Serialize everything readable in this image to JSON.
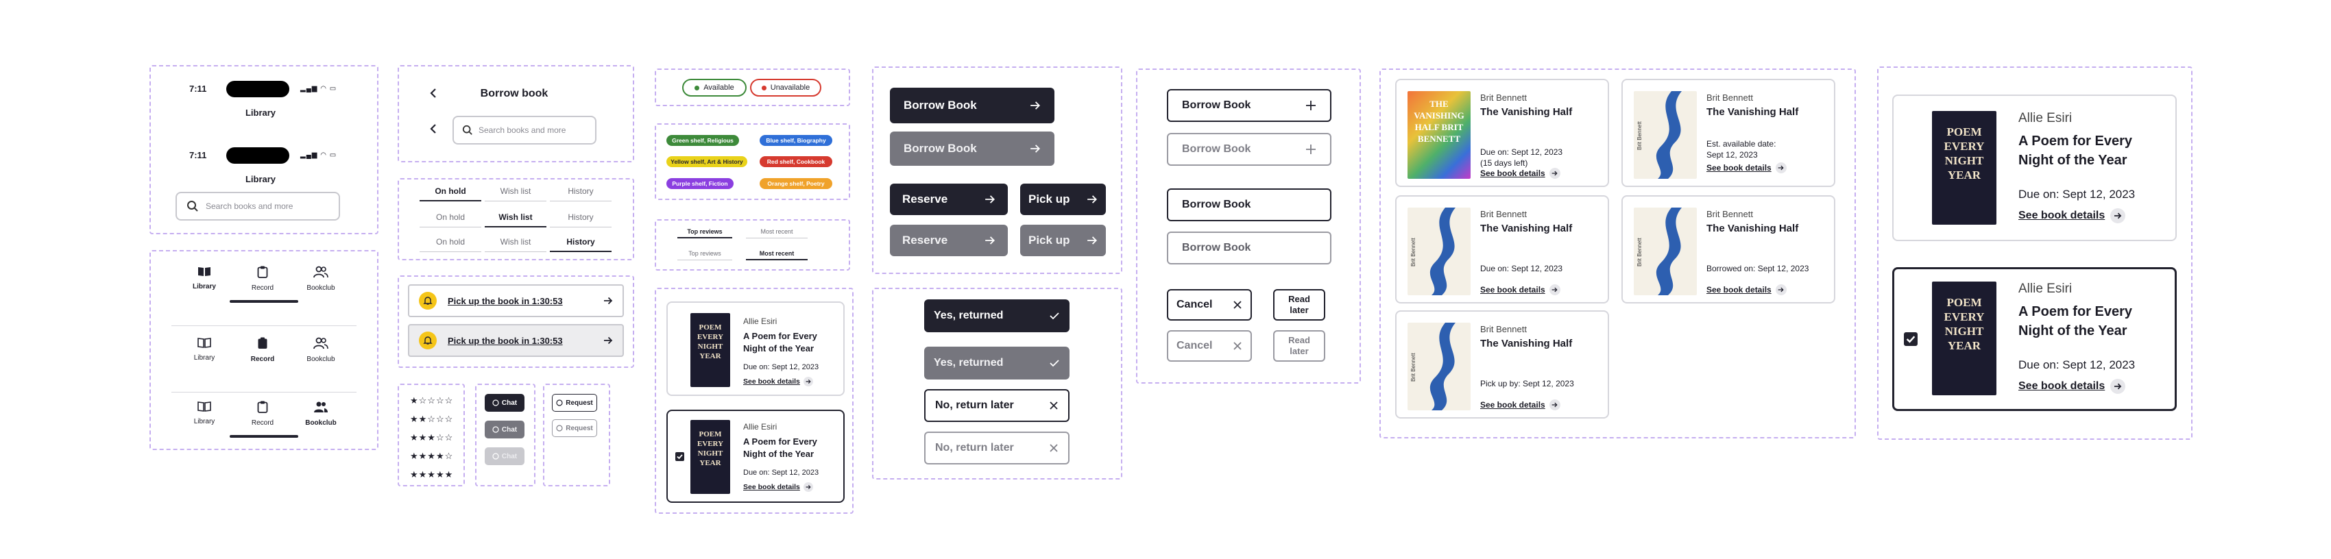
{
  "status_bar": {
    "time": "7:11"
  },
  "app_bar": {
    "title_1": "Library",
    "title_2": "Library",
    "search_placeholder": "Search books and more"
  },
  "tab_bars": [
    {
      "items": [
        {
          "label": "Library"
        },
        {
          "label": "Record"
        },
        {
          "label": "Bookclub"
        }
      ]
    },
    {
      "items": [
        {
          "label": "Library"
        },
        {
          "label": "Record"
        },
        {
          "label": "Bookclub"
        }
      ]
    },
    {
      "items": [
        {
          "label": "Library"
        },
        {
          "label": "Record"
        },
        {
          "label": "Bookclub"
        }
      ]
    }
  ],
  "borrow_header": {
    "title": "Borrow book",
    "search_placeholder": "Search books and more"
  },
  "segments": [
    [
      "On hold",
      "Wish list",
      "History"
    ],
    [
      "On hold",
      "Wish list",
      "History"
    ],
    [
      "On hold",
      "Wish list",
      "History"
    ]
  ],
  "pickup": {
    "label_1": "Pick up the book in 1:30:53",
    "label_2": "Pick up the book in 1:30:53"
  },
  "ratings": {
    "labels": [
      "1 star",
      "2 stars",
      "3 stars",
      "4 stars",
      "5 stars"
    ],
    "values": [
      1,
      2,
      3,
      4,
      5
    ],
    "max": 5
  },
  "chat": {
    "label_1": "Chat",
    "label_2": "Chat",
    "label_3": "Chat"
  },
  "request": {
    "label_1": "Request",
    "label_2": "Request"
  },
  "status_chips": {
    "available": "Available",
    "unavailable": "Unavailable"
  },
  "shelf_tags": {
    "green": "Green shelf, Religious",
    "blue": "Blue shelf, Biography",
    "yellow": "Yellow shelf, Art & History",
    "red": "Red shelf, Cookbook",
    "purple": "Purple shelf, Fiction",
    "orange": "Orange shelf, Poetry"
  },
  "review_tabs": {
    "top": "Top reviews",
    "recent": "Most recent",
    "top_2": "Top reviews",
    "recent_2": "Most recent"
  },
  "small_cards": [
    {
      "author": "Allie Esiri",
      "title": "A Poem for Every Night of the Year",
      "due": "Due on: Sept 12, 2023",
      "link": "See book details",
      "cover_text": "POEM EVERY NIGHT YEAR"
    },
    {
      "author": "Allie Esiri",
      "title": "A Poem for Every Night of the Year",
      "due": "Due on: Sept 12, 2023",
      "link": "See book details",
      "cover_text": "POEM EVERY NIGHT YEAR"
    }
  ],
  "dark_buttons": {
    "borrow": "Borrow Book",
    "borrow_2": "Borrow Book",
    "reserve": "Reserve",
    "pick_up": "Pick up",
    "reserve_2": "Reserve",
    "pick_up_2": "Pick up"
  },
  "return_buttons": {
    "yes": "Yes, returned",
    "yes_2": "Yes, returned",
    "no": "No, return later",
    "no_2": "No, return later"
  },
  "outline_buttons": {
    "borrow": "Borrow Book",
    "borrow_2": "Borrow Book",
    "borrow_3": "Borrow Book",
    "borrow_4": "Borrow Book",
    "cancel": "Cancel",
    "cancel_2": "Cancel",
    "read_later": "Read later",
    "read_later_2": "Read later"
  },
  "vanishing_cards": [
    {
      "author": "Brit Bennett",
      "title": "The Vanishing Half",
      "info": "Due on: Sept 12, 2023",
      "info_2": "(15 days left)",
      "link": "See book details",
      "cover_text": "THE VANISHING HALF BRIT BENNETT"
    },
    {
      "author": "Brit Bennett",
      "title": "The Vanishing Half",
      "info": "Est. available date:",
      "info_2": "Sept 12, 2023",
      "link": "See book details",
      "cover_text": "Brit Bennett"
    },
    {
      "author": "Brit Bennett",
      "title": "The Vanishing Half",
      "info": "Due on: Sept 12, 2023",
      "info_2": "",
      "link": "See book details",
      "cover_text": "Brit Bennett"
    },
    {
      "author": "Brit Bennett",
      "title": "The Vanishing Half",
      "info": "Borrowed on: Sept 12, 2023",
      "info_2": "",
      "link": "See book details",
      "cover_text": "Brit Bennett"
    },
    {
      "author": "Brit Bennett",
      "title": "The Vanishing Half",
      "info": "Pick up by: Sept 12, 2023",
      "info_2": "",
      "link": "See book details",
      "cover_text": "Brit Bennett"
    }
  ],
  "large_cards": [
    {
      "author": "Allie Esiri",
      "title": "A Poem for Every Night of the Year",
      "due": "Due on: Sept 12, 2023",
      "link": "See book details",
      "cover_text": "POEM EVERY NIGHT YEAR"
    },
    {
      "author": "Allie Esiri",
      "title": "A Poem for Every Night of the Year",
      "due": "Due on: Sept 12, 2023",
      "link": "See book details",
      "cover_text": "POEM EVERY NIGHT YEAR"
    }
  ],
  "icons": {
    "arrow": "arrow-right-icon",
    "plus": "plus-icon",
    "check": "check-icon",
    "close": "close-icon",
    "bell": "bell-icon",
    "search": "search-icon",
    "back": "chevron-left-icon"
  },
  "colors": {
    "dark": "#22222e",
    "gray": "#76767e",
    "frame": "#c5aef0",
    "green": "#3d8a3a",
    "red": "#d63a2f",
    "blue": "#2f6fd8",
    "yellow": "#e9d21a",
    "purple": "#8b3fe0",
    "orange": "#f0a22a"
  }
}
